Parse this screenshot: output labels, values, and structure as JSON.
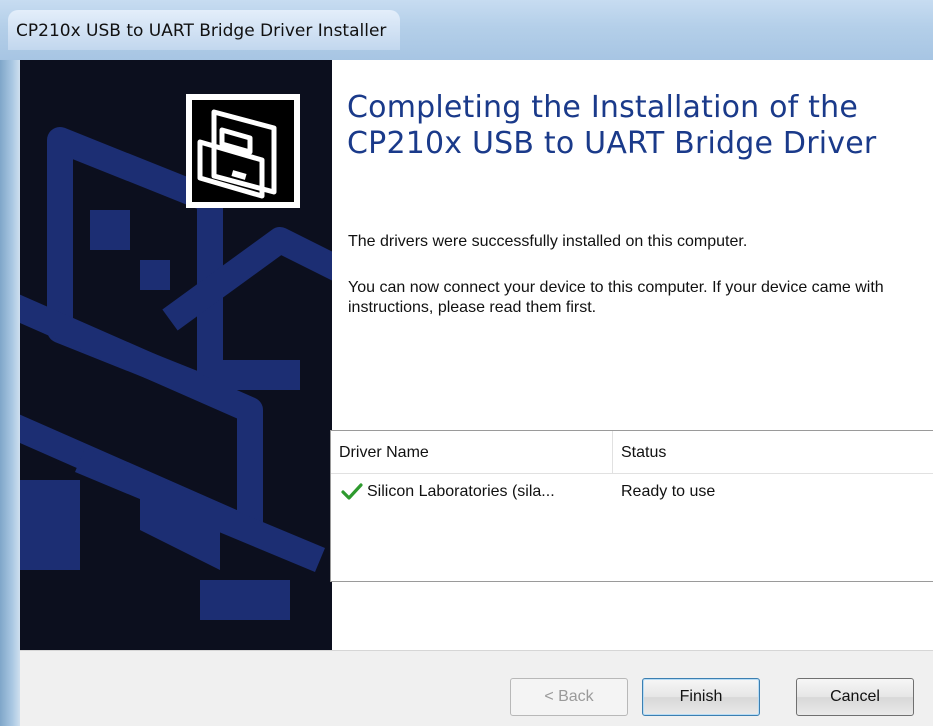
{
  "window": {
    "title": "CP210x USB to UART Bridge Driver Installer"
  },
  "heading": "Completing the Installation of the CP210x USB to UART Bridge Driver",
  "messages": {
    "success": "The drivers were successfully installed on this computer.",
    "connect": "You can now connect your device to this computer. If your device came with instructions, please read them first."
  },
  "driver_table": {
    "columns": [
      "Driver Name",
      "Status"
    ],
    "rows": [
      {
        "name": "Silicon Laboratories (sila...",
        "status": "Ready to use",
        "icon": "check-icon"
      }
    ]
  },
  "buttons": {
    "back": "< Back",
    "finish": "Finish",
    "cancel": "Cancel"
  },
  "colors": {
    "heading": "#1a3a8a",
    "side_panel": "#0c0f1e",
    "check": "#2e9a2e"
  }
}
